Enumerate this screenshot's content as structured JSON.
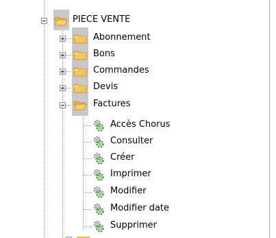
{
  "tree": {
    "root": {
      "label": "PIECE VENTE",
      "icon": "folder-open-icon",
      "state": "expanded"
    },
    "folders": [
      {
        "label": "Abonnement",
        "icon": "folder-icon",
        "state": "collapsed"
      },
      {
        "label": "Bons",
        "icon": "folder-icon",
        "state": "collapsed"
      },
      {
        "label": "Commandes",
        "icon": "folder-icon",
        "state": "collapsed"
      },
      {
        "label": "Devis",
        "icon": "folder-icon",
        "state": "collapsed"
      },
      {
        "label": "Factures",
        "icon": "folder-open-icon",
        "state": "expanded"
      }
    ],
    "actions": [
      {
        "label": "Accès Chorus",
        "icon": "permission-gear-icon"
      },
      {
        "label": "Consulter",
        "icon": "permission-gear-icon"
      },
      {
        "label": "Créer",
        "icon": "permission-gear-icon"
      },
      {
        "label": "Imprimer",
        "icon": "permission-gear-icon"
      },
      {
        "label": "Modifier",
        "icon": "permission-gear-icon"
      },
      {
        "label": "Modifier date",
        "icon": "permission-gear-icon"
      },
      {
        "label": "Supprimer",
        "icon": "permission-gear-icon"
      }
    ]
  },
  "colors": {
    "folder": "#f2c659",
    "folder_dark": "#c9962a",
    "highlight": "#c8c8c8",
    "tree_line": "#9a9a9a",
    "gear_green": "#4aa33c",
    "gear_gray": "#8c8c8c"
  }
}
